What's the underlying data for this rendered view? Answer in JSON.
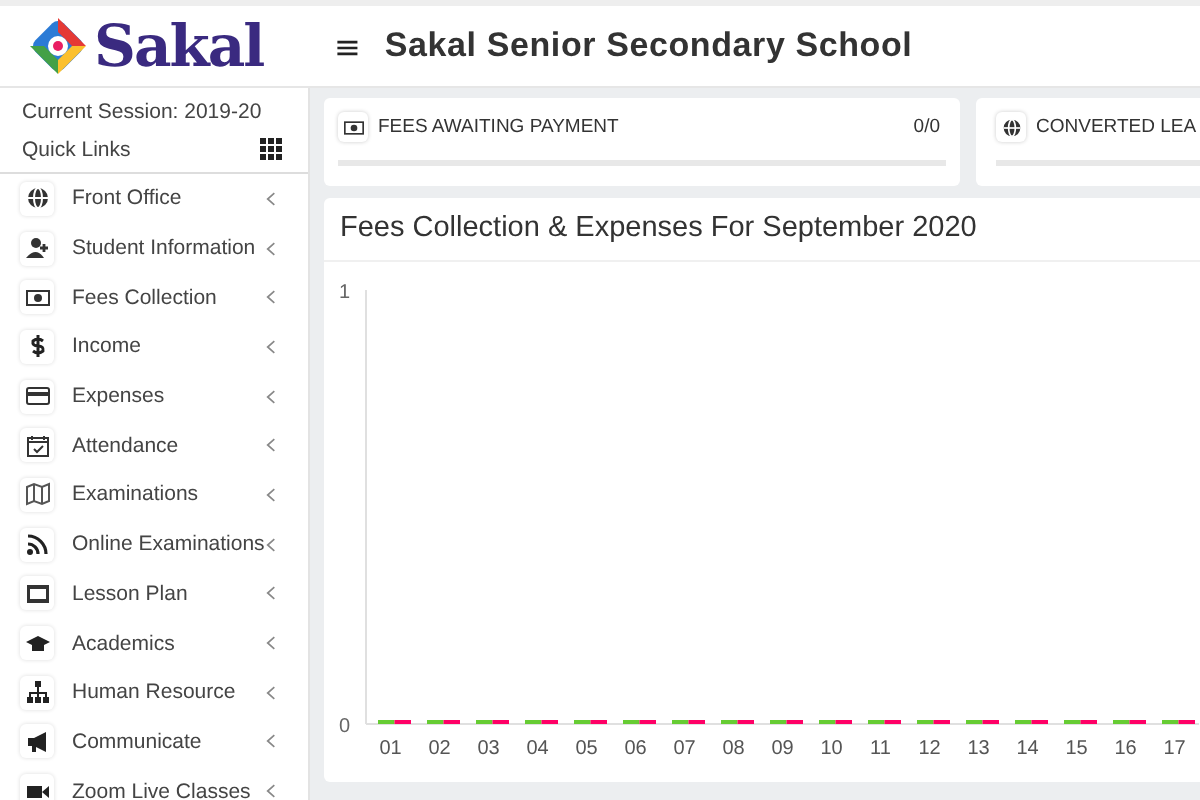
{
  "logo": {
    "text": "Sakal"
  },
  "header": {
    "menu_icon": "≡",
    "title": "Sakal Senior Secondary School"
  },
  "sidebar": {
    "session": "Current Session: 2019-20",
    "quick_links": "Quick Links",
    "items": [
      {
        "label": "Front Office"
      },
      {
        "label": "Student Information"
      },
      {
        "label": "Fees Collection"
      },
      {
        "label": "Income"
      },
      {
        "label": "Expenses"
      },
      {
        "label": "Attendance"
      },
      {
        "label": "Examinations"
      },
      {
        "label": "Online Examinations"
      },
      {
        "label": "Lesson Plan"
      },
      {
        "label": "Academics"
      },
      {
        "label": "Human Resource"
      },
      {
        "label": "Communicate"
      },
      {
        "label": "Zoom Live Classes"
      }
    ]
  },
  "stat_cards": [
    {
      "label": "FEES AWAITING PAYMENT",
      "value": "0/0",
      "level": 0
    },
    {
      "label": "CONVERTED LEA",
      "level": 0
    }
  ],
  "chart_panel": {
    "title": "Fees Collection & Expenses For September 2020",
    "chart_data": {
      "type": "bar",
      "categories": [
        "01",
        "02",
        "03",
        "04",
        "05",
        "06",
        "07",
        "08",
        "09",
        "10",
        "11",
        "12",
        "13",
        "14",
        "15",
        "16",
        "17"
      ],
      "series": [
        {
          "color": "#66cc33",
          "values": [
            0,
            0,
            0,
            0,
            0,
            0,
            0,
            0,
            0,
            0,
            0,
            0,
            0,
            0,
            0,
            0,
            0
          ]
        },
        {
          "color": "#ff0066",
          "values": [
            0,
            0,
            0,
            0,
            0,
            0,
            0,
            0,
            0,
            0,
            0,
            0,
            0,
            0,
            0,
            0,
            0
          ]
        }
      ],
      "ylim": [
        0,
        1
      ],
      "yticks": [
        0,
        1
      ]
    }
  }
}
